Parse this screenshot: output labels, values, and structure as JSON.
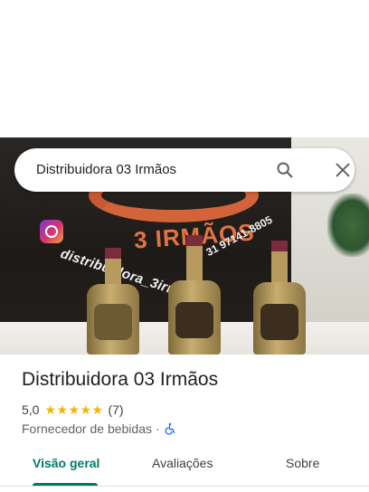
{
  "search": {
    "value": "Distribuidora 03 Irmãos",
    "search_icon": "search-icon",
    "close_icon": "close-icon"
  },
  "photo": {
    "wall_logo_text": "3 IRMÃOS",
    "instagram_handle": "distribuidora_3irmaos",
    "phone": "31 97141-8805"
  },
  "place": {
    "name": "Distribuidora 03 Irmãos",
    "rating": "5,0",
    "stars": 5,
    "review_count": "(7)",
    "category": "Fornecedor de bebidas",
    "separator": "·",
    "accessibility_icon": "wheelchair-icon"
  },
  "tabs": [
    {
      "label": "Visão geral",
      "active": true
    },
    {
      "label": "Avaliações",
      "active": false
    },
    {
      "label": "Sobre",
      "active": false
    }
  ],
  "colors": {
    "accent": "#00796b",
    "star": "#f4b400",
    "logo_orange": "#e2733f"
  }
}
